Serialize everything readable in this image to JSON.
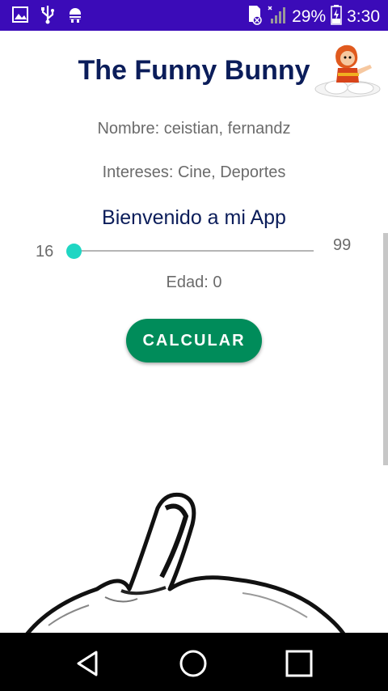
{
  "status_bar": {
    "battery_percent": "29%",
    "time": "3:30",
    "icons": [
      "image-icon",
      "usb-icon",
      "android-debug-icon",
      "sd-card-error-icon",
      "signal-icon",
      "battery-charging-icon"
    ]
  },
  "app": {
    "title": "The Funny Bunny",
    "nombre": "Nombre: ceistian, fernandz",
    "intereses": "Intereses: Cine, Deportes",
    "welcome": "Bienvenido a mi App",
    "slider": {
      "min_label": "16",
      "max_label": "99",
      "value_fraction": 0
    },
    "edad": "Edad: 0",
    "calc_button": "CALCULAR"
  },
  "colors": {
    "status_bar": "#3b0bb8",
    "title": "#0b1d5a",
    "accent": "#1fd6c3",
    "button": "#008c5a"
  },
  "nav_bar": {
    "icons": [
      "back-icon",
      "home-icon",
      "recents-icon"
    ]
  }
}
